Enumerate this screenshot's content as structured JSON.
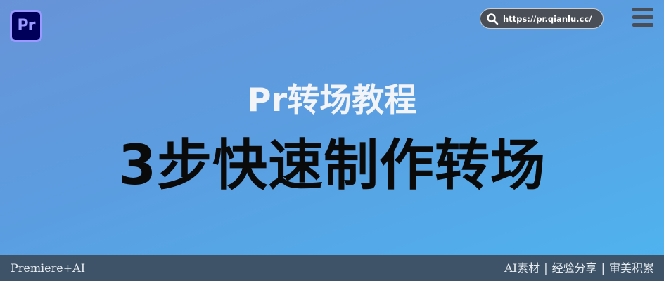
{
  "header": {
    "logo_text": "Pr",
    "url": "https://pr.qianlu.cc/"
  },
  "hero": {
    "subtitle": "Pr转场教程",
    "title": "3步快速制作转场"
  },
  "footer": {
    "left_text": "Premiere+AI",
    "tags": [
      "AI素材",
      "经验分享",
      "审美积累"
    ],
    "separator": "|"
  },
  "colors": {
    "gradient_start": "#6893d8",
    "gradient_end": "#4fb3ee",
    "footer_bg": "#3e5367",
    "url_pill_bg": "#4a4f57",
    "logo_bg": "#00005b",
    "logo_fg": "#9999ff"
  },
  "icons": {
    "search": "search-icon",
    "menu": "hamburger-menu-icon",
    "logo": "premiere-pro-logo"
  }
}
